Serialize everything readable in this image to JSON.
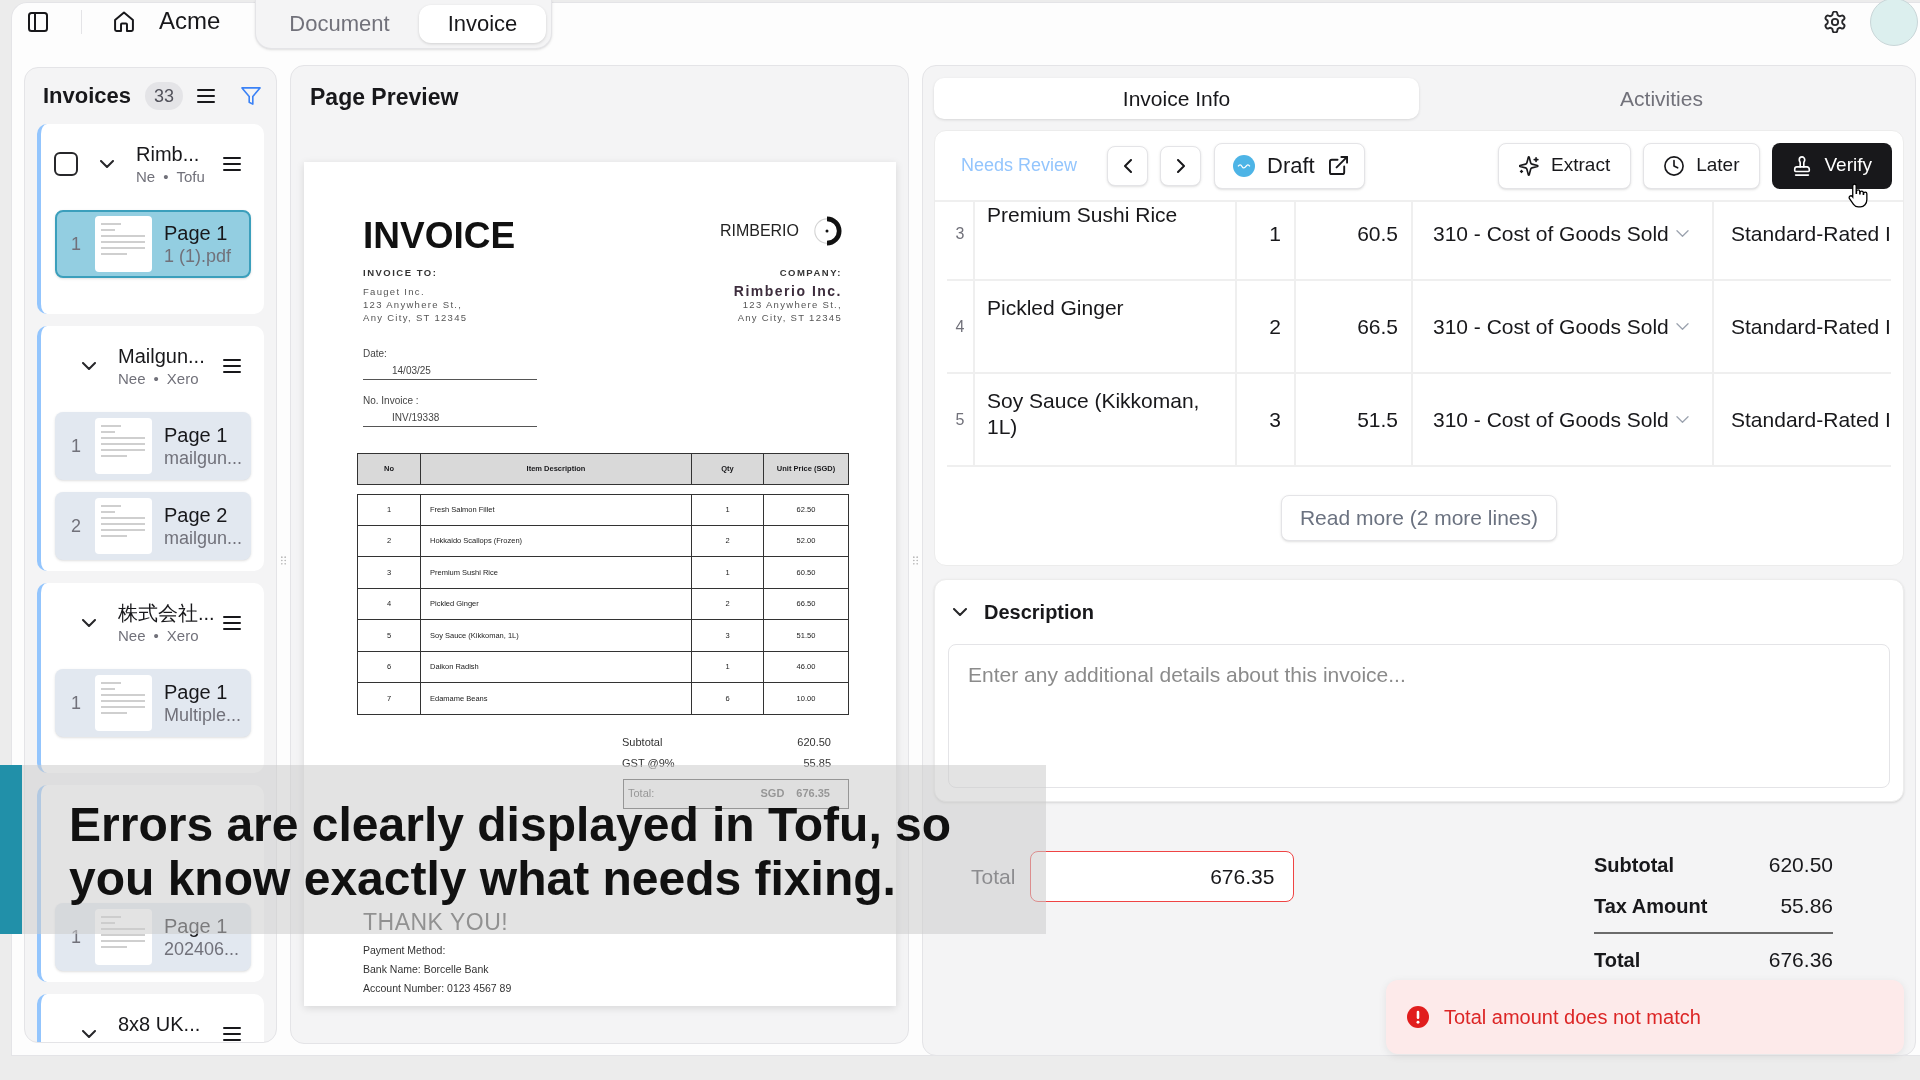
{
  "top_bar": {
    "brand": "Acme",
    "tabs": [
      {
        "label": "Document",
        "selected": false
      },
      {
        "label": "Invoice",
        "selected": true
      }
    ]
  },
  "sidebar": {
    "title": "Invoices",
    "count": "33",
    "invoices": [
      {
        "title": "Rimb...",
        "status": "Ne",
        "bullet": "•",
        "source": "Tofu",
        "checkbox": {
          "checked": false
        },
        "pages": [
          {
            "number": "1",
            "title": "Page 1",
            "file": "1 (1).pdf",
            "selected": true
          }
        ]
      },
      {
        "title": "Mailgun...",
        "status": "Nee",
        "bullet": "•",
        "source": "Xero",
        "pages": [
          {
            "number": "1",
            "title": "Page 1",
            "file": "mailgun...",
            "selected": false
          },
          {
            "number": "2",
            "title": "Page 2",
            "file": "mailgun...",
            "selected": false
          }
        ]
      },
      {
        "title": "株式会社...",
        "status": "Nee",
        "bullet": "•",
        "source": "Xero",
        "pages": [
          {
            "number": "1",
            "title": "Page 1",
            "file": "Multiple...",
            "selected": false
          }
        ]
      },
      {
        "pages": [
          {
            "number": "1",
            "title": "Page 1",
            "file": "202406...",
            "selected": false
          }
        ]
      },
      {
        "title": "8x8 UK..."
      }
    ]
  },
  "page_preview": {
    "title": "Page Preview",
    "document": {
      "heading": "INVOICE",
      "brand": "RIMBERIO",
      "bill_to_label": "INVOICE TO:",
      "bill_to_lines": [
        "Fauget Inc.",
        "123 Anywhere St.,",
        "Any City, ST 12345"
      ],
      "company_label": "COMPANY:",
      "company_name": "Rimberio Inc.",
      "company_lines": [
        "123 Anywhere St.,",
        "Any City, ST 12345"
      ],
      "fields": [
        {
          "label": "Date:",
          "value": "14/03/25"
        },
        {
          "label": "No. Invoice :",
          "value": "INV/19338"
        }
      ],
      "table": {
        "columns": [
          "No",
          "Item Description",
          "Qty",
          "Unit Price (SGD)"
        ],
        "rows": [
          [
            "1",
            "Fresh Salmon Fillet",
            "1",
            "62.50"
          ],
          [
            "2",
            "Hokkaido Scallops (Frozen)",
            "2",
            "52.00"
          ],
          [
            "3",
            "Premium Sushi Rice",
            "1",
            "60.50"
          ],
          [
            "4",
            "Pickled Ginger",
            "2",
            "66.50"
          ],
          [
            "5",
            "Soy Sauce (Kikkoman, 1L)",
            "3",
            "51.50"
          ],
          [
            "6",
            "Daikon Radish",
            "1",
            "46.00"
          ],
          [
            "7",
            "Edamame Beans",
            "6",
            "10.00"
          ]
        ]
      },
      "totals": [
        {
          "label": "Subtotal",
          "value": "620.50"
        },
        {
          "label": "GST @9%",
          "value": "55.85"
        }
      ],
      "grand_total": {
        "label": "Total:",
        "currency": "SGD",
        "value": "676.35"
      },
      "thank_you": "THANK YOU!",
      "payment_lines": [
        "Payment Method:",
        "Bank Name: Borcelle Bank",
        "Account Number: 0123 4567 89"
      ]
    }
  },
  "details": {
    "tabs": [
      {
        "label": "Invoice Info",
        "selected": true
      },
      {
        "label": "Activities",
        "selected": false
      }
    ],
    "toolbar": {
      "status": "Needs Review",
      "draft": "Draft",
      "actions": [
        {
          "kind": "extract",
          "label": "Extract",
          "primary": false
        },
        {
          "kind": "later",
          "label": "Later",
          "primary": false
        },
        {
          "kind": "verify",
          "label": "Verify",
          "primary": true
        }
      ]
    },
    "line_items": [
      {
        "no": "3",
        "description": "Premium Sushi Rice",
        "qty": "1",
        "unit_price": "60.5",
        "account": "310 - Cost of Goods Sold",
        "tax_rate": "Standard-Rated I"
      },
      {
        "no": "4",
        "description": "Pickled Ginger",
        "qty": "2",
        "unit_price": "66.5",
        "account": "310 - Cost of Goods Sold",
        "tax_rate": "Standard-Rated I"
      },
      {
        "no": "5",
        "description": "Soy Sauce (Kikkoman, 1L)",
        "qty": "3",
        "unit_price": "51.5",
        "account": "310 - Cost of Goods Sold",
        "tax_rate": "Standard-Rated I"
      }
    ],
    "read_more": "Read more (2 more lines)"
  },
  "description": {
    "title": "Description",
    "expanded": true,
    "placeholder": "Enter any additional details about this invoice..."
  },
  "totals": {
    "label": "Total",
    "value": "676.35",
    "invalid": true,
    "summary": [
      {
        "label": "Subtotal",
        "value": "620.50"
      },
      {
        "label": "Tax Amount",
        "value": "55.86"
      },
      {
        "label": "Total",
        "value": "676.36"
      }
    ]
  },
  "toast": {
    "message": "Total amount does not match"
  },
  "caption": "Errors are clearly displayed in Tofu, so you know exactly what needs fixing."
}
